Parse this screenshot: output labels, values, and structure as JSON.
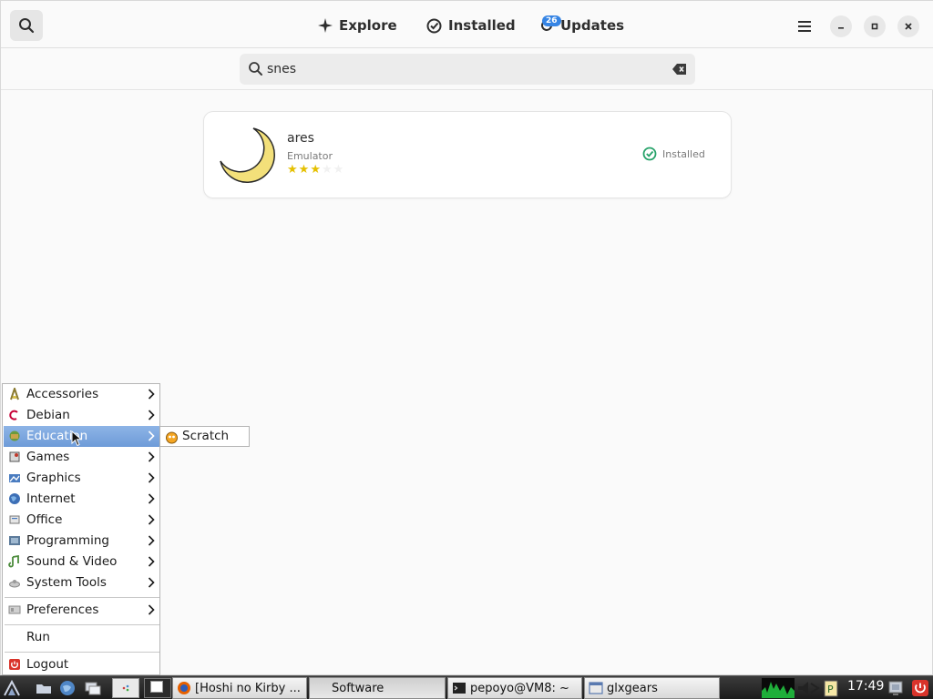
{
  "app": {
    "tabs": [
      {
        "label": "Explore",
        "icon": "sparkle-icon"
      },
      {
        "label": "Installed",
        "icon": "check-circle-icon"
      },
      {
        "label": "Updates",
        "icon": "refresh-icon",
        "badge": "26"
      }
    ],
    "search": {
      "value": "snes"
    },
    "results": [
      {
        "name": "ares",
        "category": "Emulator",
        "rating_stars": 3,
        "max_stars": 5,
        "status": "Installed",
        "icon": "moon-icon"
      }
    ]
  },
  "start_menu": {
    "items": [
      {
        "label": "Accessories",
        "icon": "accessories-icon",
        "submenu": true
      },
      {
        "label": "Debian",
        "icon": "debian-icon",
        "submenu": true
      },
      {
        "label": "Education",
        "icon": "education-icon",
        "submenu": true,
        "selected": true
      },
      {
        "label": "Games",
        "icon": "games-icon",
        "submenu": true
      },
      {
        "label": "Graphics",
        "icon": "graphics-icon",
        "submenu": true
      },
      {
        "label": "Internet",
        "icon": "internet-icon",
        "submenu": true
      },
      {
        "label": "Office",
        "icon": "office-icon",
        "submenu": true
      },
      {
        "label": "Programming",
        "icon": "programming-icon",
        "submenu": true
      },
      {
        "label": "Sound & Video",
        "icon": "sound-video-icon",
        "submenu": true
      },
      {
        "label": "System Tools",
        "icon": "system-tools-icon",
        "submenu": true
      }
    ],
    "preferences": {
      "label": "Preferences",
      "icon": "preferences-icon"
    },
    "run": {
      "label": "Run"
    },
    "logout": {
      "label": "Logout",
      "icon": "logout-icon"
    },
    "education_submenu": [
      {
        "label": "Scratch",
        "icon": "scratch-icon"
      }
    ]
  },
  "taskbar": {
    "tasks": [
      {
        "label": "[Hoshi no Kirby ...",
        "icon": "firefox-icon"
      },
      {
        "label": "Software",
        "active": true
      },
      {
        "label": "pepoyo@VM8: ~",
        "icon": "terminal-icon"
      },
      {
        "label": "glxgears",
        "icon": "window-icon"
      }
    ],
    "clock": "17:49"
  },
  "colors": {
    "accent": "#3584e4",
    "installed_green": "#26a269",
    "star": "#e5c000",
    "menu_selected": "#7aa5dd"
  }
}
